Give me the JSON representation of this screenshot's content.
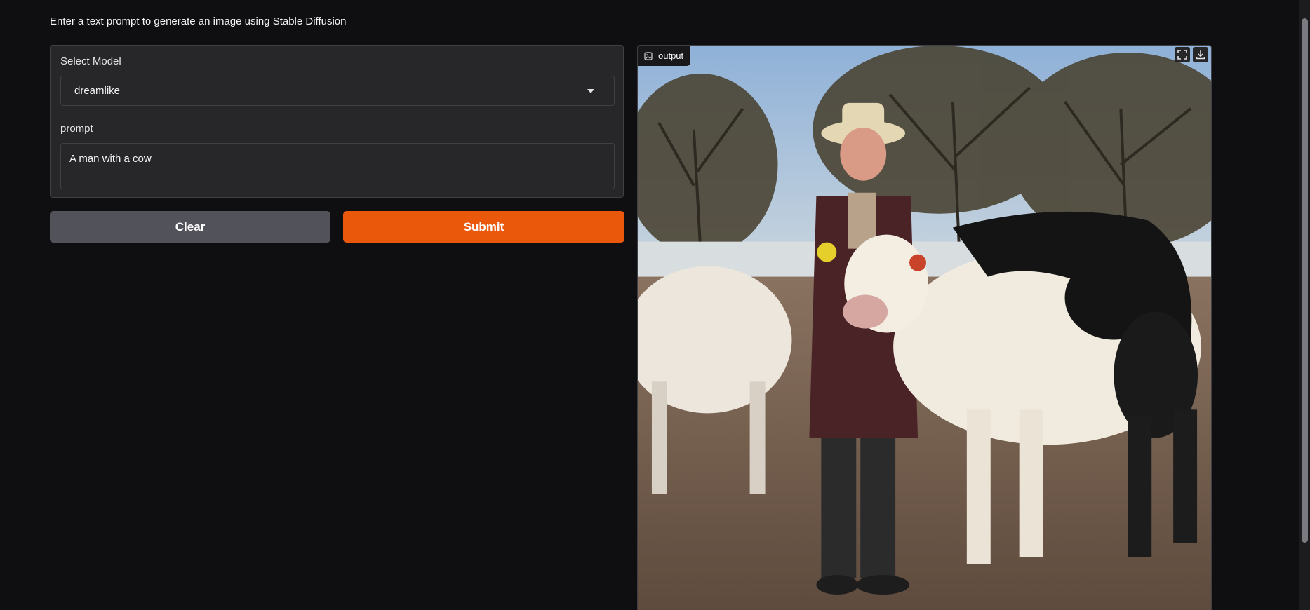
{
  "page": {
    "description": "Enter a text prompt to generate an image using Stable Diffusion"
  },
  "inputs": {
    "model_label": "Select Model",
    "model_value": "dreamlike",
    "prompt_label": "prompt",
    "prompt_value": "A man with a cow"
  },
  "buttons": {
    "clear_label": "Clear",
    "submit_label": "Submit"
  },
  "output": {
    "label": "output",
    "image_alt": "A man with a cow",
    "fullscreen_icon": "fullscreen-icon",
    "download_icon": "download-icon"
  },
  "colors": {
    "background": "#0f0f11",
    "panel": "#27272a",
    "border": "#3f3f46",
    "clear_button": "#52525b",
    "submit_button": "#ea580c"
  }
}
